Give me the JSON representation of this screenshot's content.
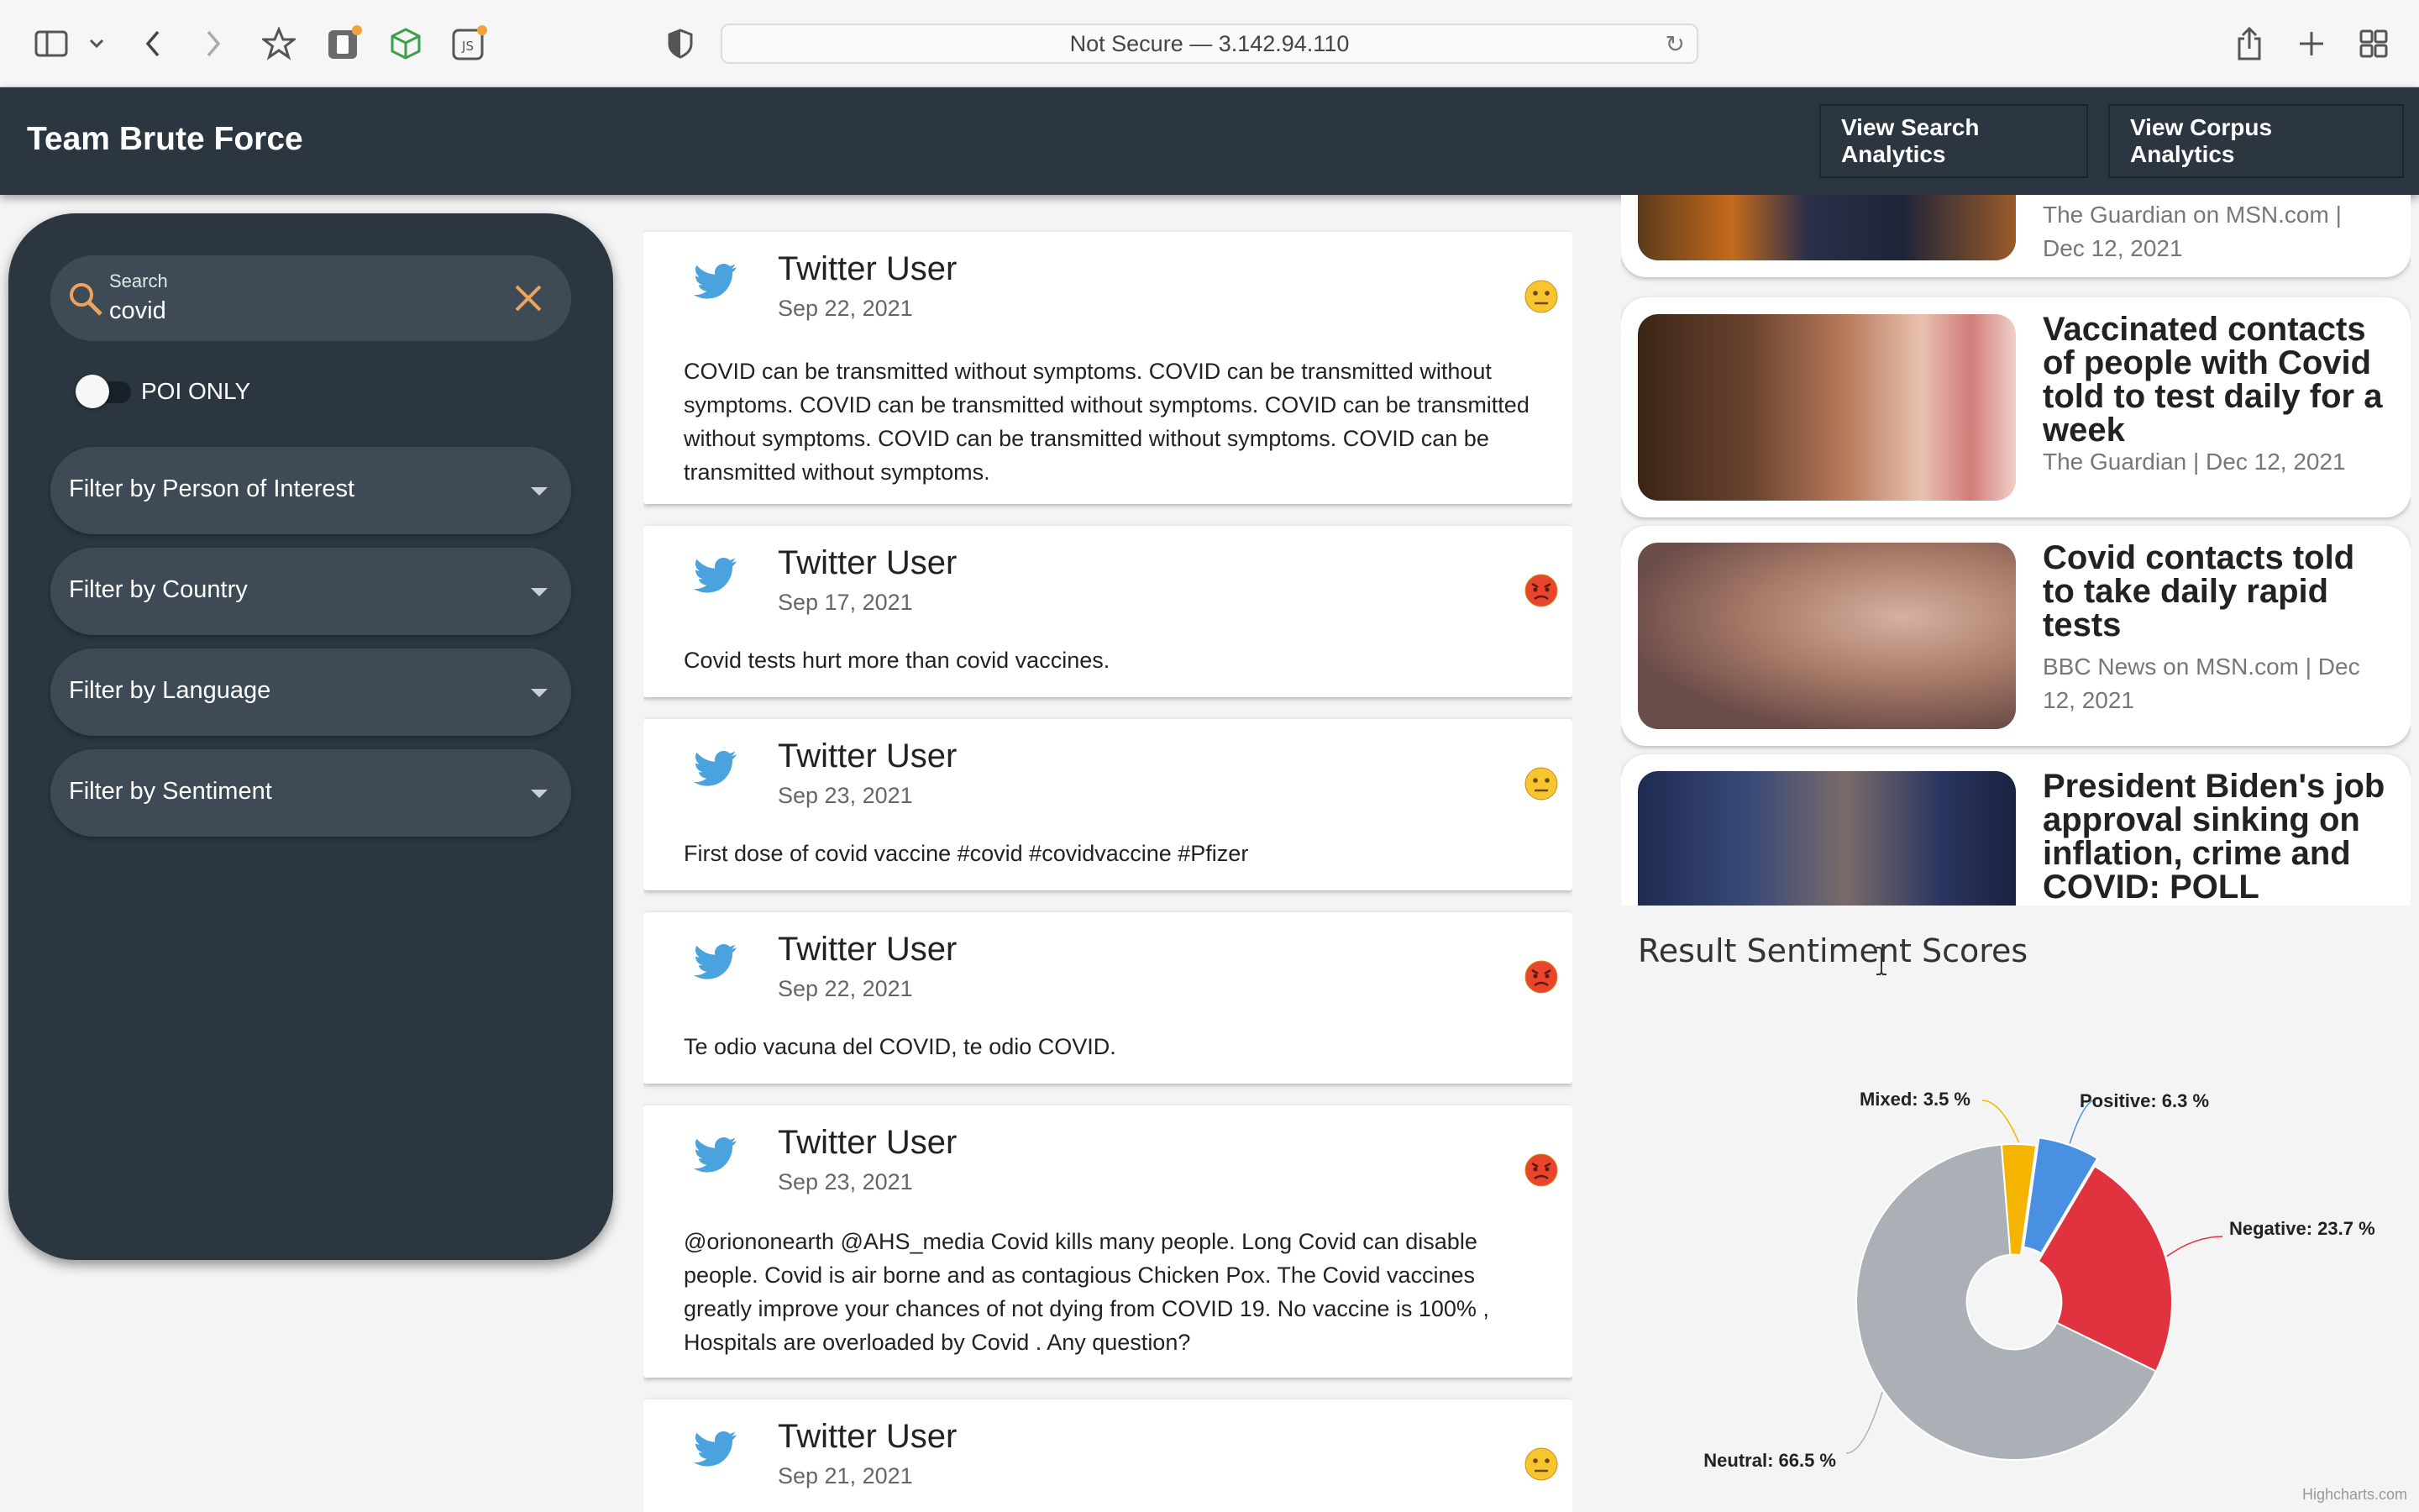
{
  "browser": {
    "url": "Not Secure — 3.142.94.110"
  },
  "app": {
    "title": "Team Brute Force",
    "nav": [
      "View Search Analytics",
      "View Corpus Analytics"
    ]
  },
  "sidebar": {
    "search_label": "Search",
    "search_value": "covid",
    "poi_toggle_label": "POI ONLY",
    "poi_toggle_on": false,
    "filters": [
      "Filter by Person of Interest",
      "Filter by Country",
      "Filter by Language",
      "Filter by Sentiment"
    ]
  },
  "tweets": [
    {
      "user": "Twitter User",
      "date": "Sep 22, 2021",
      "sentiment": "neutral",
      "text": "COVID can be transmitted without symptoms. COVID can be transmitted without symptoms. COVID can be transmitted without symptoms. COVID can be transmitted without symptoms. COVID can be transmitted without symptoms. COVID can be transmitted without symptoms."
    },
    {
      "user": "Twitter User",
      "date": "Sep 17, 2021",
      "sentiment": "negative",
      "text": "Covid tests hurt more than covid vaccines."
    },
    {
      "user": "Twitter User",
      "date": "Sep 23, 2021",
      "sentiment": "neutral",
      "text": "First dose of covid vaccine #covid #covidvaccine #Pfizer"
    },
    {
      "user": "Twitter User",
      "date": "Sep 22, 2021",
      "sentiment": "negative",
      "text": "Te odio vacuna del COVID, te odio COVID."
    },
    {
      "user": "Twitter User",
      "date": "Sep 23, 2021",
      "sentiment": "negative",
      "text": "@oriononearth @AHS_media Covid kills many people. Long Covid can disable people. Covid is air borne and as contagious Chicken Pox. The Covid vaccines greatly improve your chances of not dying from COVID 19. No vaccine is 100% , Hospitals are overloaded by Covid . Any question?"
    },
    {
      "user": "Twitter User",
      "date": "Sep 21, 2021",
      "sentiment": "neutral",
      "text": ""
    }
  ],
  "news": [
    {
      "title": "",
      "source": "The Guardian on MSN.com | Dec 12, 2021"
    },
    {
      "title": "Vaccinated contacts of people with Covid told to test daily for a week",
      "source": "The Guardian | Dec 12, 2021"
    },
    {
      "title": "Covid contacts told to take daily rapid tests",
      "source": "BBC News on MSN.com | Dec 12, 2021"
    },
    {
      "title": "President Biden's job approval sinking on inflation, crime and COVID: POLL",
      "source": ""
    }
  ],
  "chart_data": {
    "type": "pie",
    "title": "Result Sentiment Scores",
    "inner_radius_ratio": 0.3,
    "slices": [
      {
        "name": "Positive",
        "value": 6.3,
        "color": "#4a90e2",
        "label": "Positive: 6.3 %"
      },
      {
        "name": "Negative",
        "value": 23.7,
        "color": "#e0323f",
        "label": "Negative: 23.7 %"
      },
      {
        "name": "Neutral",
        "value": 66.5,
        "color": "#aab0b6",
        "label": "Neutral: 66.5 %"
      },
      {
        "name": "Mixed",
        "value": 3.5,
        "color": "#f5b400",
        "label": "Mixed: 3.5 %"
      }
    ],
    "credits": "Highcharts.com"
  }
}
